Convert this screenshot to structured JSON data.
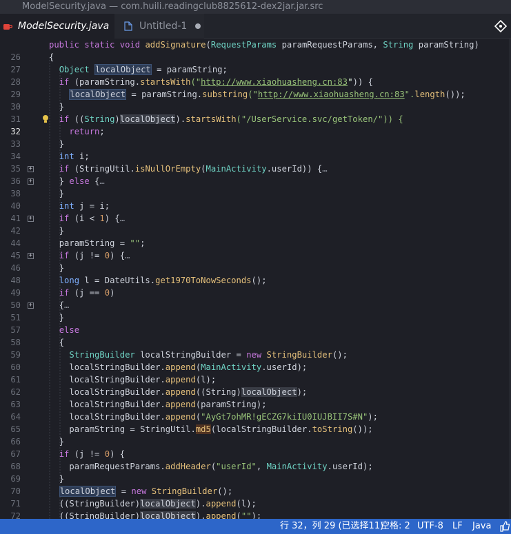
{
  "window": {
    "title": "ModelSecurity.java — com.huili.readingclub8825612-dex2jar.jar.src"
  },
  "tabs": [
    {
      "label": "ModelSecurity.java",
      "icon": "java-coffee-icon",
      "close": "×",
      "active": true
    },
    {
      "label": "Untitled-1",
      "icon": "file-icon",
      "modified": true,
      "active": false
    }
  ],
  "editor": {
    "current_line": 32,
    "lines": [
      {
        "n": "26"
      },
      {
        "n": "27"
      },
      {
        "n": "28"
      },
      {
        "n": "29"
      },
      {
        "n": "30"
      },
      {
        "n": "31"
      },
      {
        "n": "32"
      },
      {
        "n": "33"
      },
      {
        "n": "34"
      },
      {
        "n": "35"
      },
      {
        "n": "36"
      },
      {
        "n": "38"
      },
      {
        "n": "40"
      },
      {
        "n": "41"
      },
      {
        "n": "42"
      },
      {
        "n": "44"
      },
      {
        "n": "45"
      },
      {
        "n": "46"
      },
      {
        "n": "48"
      },
      {
        "n": "49"
      },
      {
        "n": "50"
      },
      {
        "n": "51"
      },
      {
        "n": "57"
      },
      {
        "n": "58"
      },
      {
        "n": "59"
      },
      {
        "n": "60"
      },
      {
        "n": "61"
      },
      {
        "n": "62"
      },
      {
        "n": "63"
      },
      {
        "n": "64"
      },
      {
        "n": "65"
      },
      {
        "n": "66"
      },
      {
        "n": "67"
      },
      {
        "n": "68"
      },
      {
        "n": "69"
      },
      {
        "n": "70"
      },
      {
        "n": "71"
      },
      {
        "n": "72"
      },
      {
        "n": "73"
      }
    ],
    "code": {
      "l26_a": "public",
      "l26_b": "static",
      "l26_c": "void",
      "l26_d": "addSignature",
      "l26_e": "RequestParams",
      "l26_f": "paramRequestParams,",
      "l26_g": "String",
      "l26_h": "paramString)",
      "l27": "{",
      "l28_a": "Object",
      "l28_b": "localObject",
      "l28_c": " = paramString;",
      "l29_a": "if",
      "l29_b": " (paramString.",
      "l29_c": "startsWith",
      "l29_d": "(\"",
      "l29_e": "http://www.xiaohuasheng.cn:83",
      "l29_f": "\")) {",
      "l30_a": "localObject",
      "l30_b": " = paramString.",
      "l30_c": "substring",
      "l30_d": "(\"",
      "l30_e": "http://www.xiaohuasheng.cn:83",
      "l30_f": "\".",
      "l30_g": "length",
      "l30_h": "());",
      "l31": "}",
      "l32_a": "if",
      "l32_b": " ((",
      "l32_c": "String",
      "l32_d": ")",
      "l32_e": "localObject",
      "l32_f": ").",
      "l32_g": "startsWith",
      "l32_h": "(\"/UserService.svc/getToken/\")) {",
      "l33_a": "return",
      "l33_b": ";",
      "l34": "}",
      "l35_a": "int",
      "l35_b": " i;",
      "l36_a": "if",
      "l36_b": " (StringUtil.",
      "l36_c": "isNullOrEmpty",
      "l36_d": "(",
      "l36_e": "MainActivity",
      "l36_f": ".userId)) {",
      "l36_g": "…",
      "l38_a": "} ",
      "l38_b": "else",
      "l38_c": " {",
      "l38_d": "…",
      "l40": "}",
      "l41_a": "int",
      "l41_b": " j = i;",
      "l42_a": "if",
      "l42_b": " (i < ",
      "l42_c": "1",
      "l42_d": ") {",
      "l42_e": "…",
      "l44": "}",
      "l45_a": "paramString = ",
      "l45_b": "\"\"",
      "l45_c": ";",
      "l46_a": "if",
      "l46_b": " (j != ",
      "l46_c": "0",
      "l46_d": ") {",
      "l46_e": "…",
      "l48": "}",
      "l49_a": "long",
      "l49_b": " l = DateUtils.",
      "l49_c": "get1970ToNowSeconds",
      "l49_d": "();",
      "l50_a": "if",
      "l50_b": " (j == ",
      "l50_c": "0",
      "l50_d": ")",
      "l51_a": "{",
      "l51_b": "…",
      "l57": "}",
      "l58": "else",
      "l59": "{",
      "l60_a": "StringBuilder",
      "l60_b": " localStringBuilder = ",
      "l60_c": "new",
      "l60_d": " ",
      "l60_e": "StringBuilder",
      "l60_f": "();",
      "l61_a": "localStringBuilder.",
      "l61_b": "append",
      "l61_c": "(",
      "l61_d": "MainActivity",
      "l61_e": ".userId);",
      "l62_a": "localStringBuilder.",
      "l62_b": "append",
      "l62_c": "(l);",
      "l63_a": "localStringBuilder.",
      "l63_b": "append",
      "l63_c": "((String)",
      "l63_d": "localObject",
      "l63_e": ");",
      "l64_a": "localStringBuilder.",
      "l64_b": "append",
      "l64_c": "(paramString);",
      "l65_a": "localStringBuilder.",
      "l65_b": "append",
      "l65_c": "(",
      "l65_d": "\"AyGt7ohMR!gECZG7kiIU0IUJBII7S#N\"",
      "l65_e": ");",
      "l66_a": "paramString = StringUtil.",
      "l66_b": "md5",
      "l66_c": "(",
      "l66_d": "localStringBuilder.",
      "l66_e": "toString",
      "l66_f": "());",
      "l67": "}",
      "l68_a": "if",
      "l68_b": " (j != ",
      "l68_c": "0",
      "l68_d": ") {",
      "l69_a": "paramRequestParams.",
      "l69_b": "addHeader",
      "l69_c": "(",
      "l69_d": "\"userId\"",
      "l69_e": ", ",
      "l69_f": "MainActivity",
      "l69_g": ".userId);",
      "l70": "}",
      "l71_a": "localObject",
      "l71_b": " = ",
      "l71_c": "new",
      "l71_d": " ",
      "l71_e": "StringBuilder",
      "l71_f": "();",
      "l72_a": "((StringBuilder)",
      "l72_b": "localObject",
      "l72_c": ").",
      "l72_d": "append",
      "l72_e": "(l);",
      "l73_a": "((StringBuilder)",
      "l73_b": "localObject",
      "l73_c": ").",
      "l73_d": "append",
      "l73_e": "(",
      "l73_f": "\"\"",
      "l73_g": ");"
    }
  },
  "status": {
    "position": "行 32，列 29 (已选择11)",
    "indent": "空格: 2",
    "encoding": "UTF-8",
    "eol": "LF",
    "language": "Java"
  },
  "colors": {
    "accent": "#2d66c9",
    "background": "#1e1f26",
    "keyword": "#c678dd",
    "string": "#98c379"
  }
}
